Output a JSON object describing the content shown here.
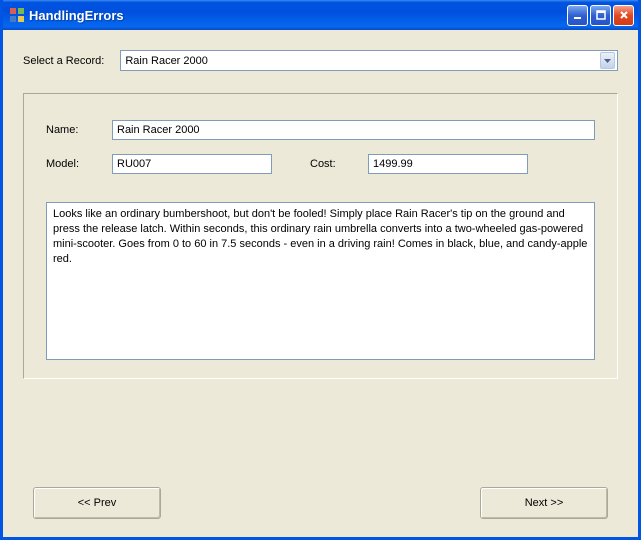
{
  "window": {
    "title": "HandlingErrors"
  },
  "selector": {
    "label": "Select a Record:",
    "value": "Rain Racer 2000"
  },
  "fields": {
    "name_label": "Name:",
    "name_value": "Rain Racer 2000",
    "model_label": "Model:",
    "model_value": "RU007",
    "cost_label": "Cost:",
    "cost_value": "1499.99",
    "description_value": "Looks like an ordinary bumbershoot, but don't be fooled! Simply place Rain Racer's tip on the ground and press the release latch. Within seconds, this ordinary rain umbrella converts into a two-wheeled gas-powered mini-scooter. Goes from 0 to 60 in 7.5 seconds - even in a driving rain! Comes in black, blue, and candy-apple red."
  },
  "buttons": {
    "prev": "<< Prev",
    "next": "Next >>"
  }
}
